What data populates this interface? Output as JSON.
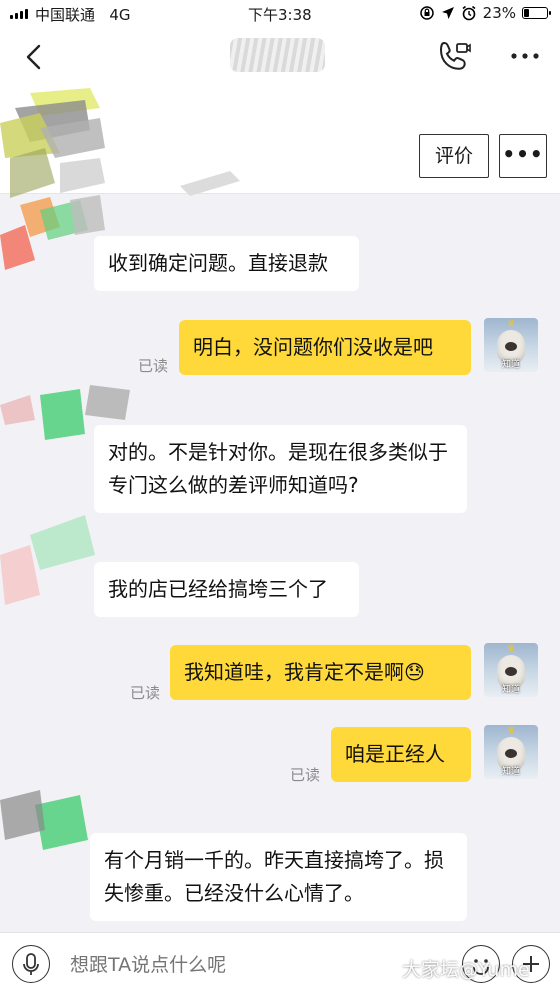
{
  "status_bar": {
    "carrier": "中国联通",
    "network": "4G",
    "time": "下午3:38",
    "battery": "23%",
    "battery_level": 0.23
  },
  "header": {
    "rate_label": "评价",
    "more_label": "•••"
  },
  "messages": [
    {
      "side": "in",
      "text": "收到确定问题。直接退款"
    },
    {
      "side": "out",
      "text": "明白，没问题你们没收是吧",
      "status": "已读"
    },
    {
      "side": "in",
      "text": "对的。不是针对你。是现在很多类似于专门这么做的差评师知道吗?"
    },
    {
      "side": "in",
      "text": "我的店已经给搞垮三个了"
    },
    {
      "side": "out",
      "text": "我知道哇，我肯定不是啊",
      "emoji": "😓",
      "status": "已读"
    },
    {
      "side": "out",
      "text": "咱是正经人",
      "status": "已读"
    },
    {
      "side": "in",
      "text": "有个月销一千的。昨天直接搞垮了。损失惨重。已经没什么心情了。"
    }
  ],
  "avatar_caption": "知道",
  "input": {
    "placeholder": "想跟TA说点什么呢"
  },
  "watermark": "大家坛@Yume"
}
